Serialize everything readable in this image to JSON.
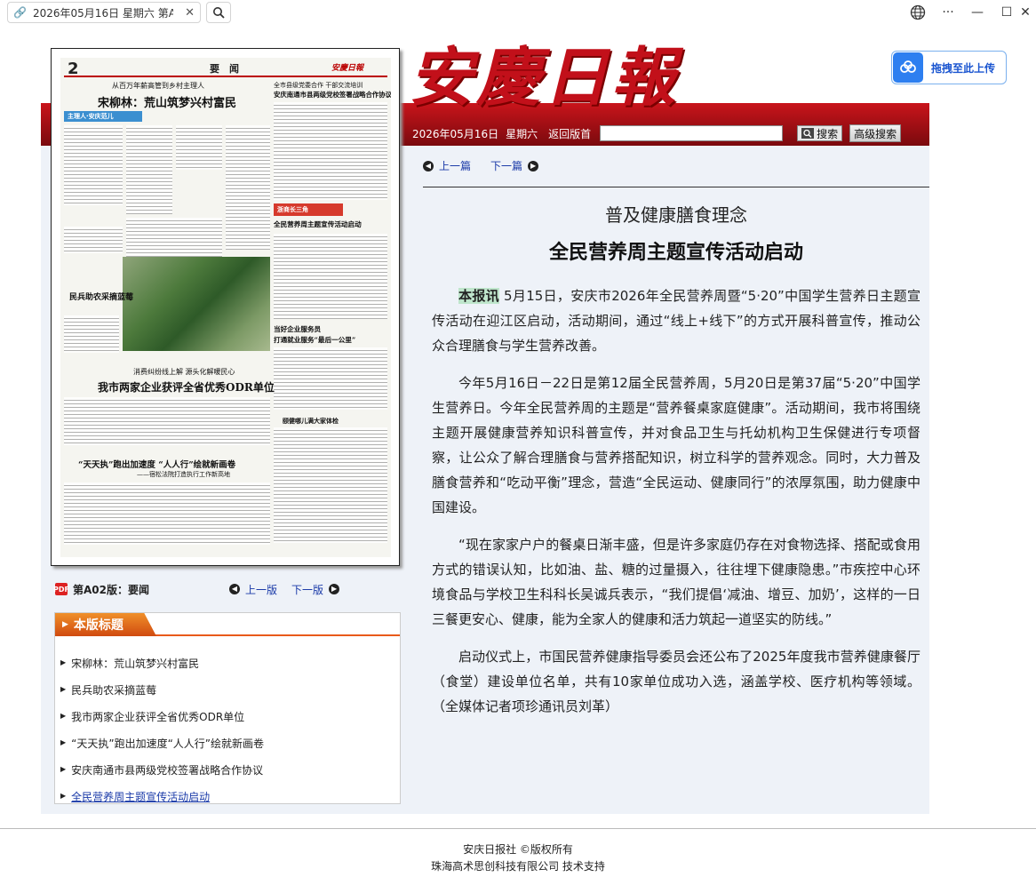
{
  "browser": {
    "tab_title": "2026年05月16日 星期六 第A",
    "tab_close": "✕",
    "search_icon": "magnifier-icon",
    "controls": {
      "globe": "🌐",
      "more": "···",
      "minimize": "—",
      "maximize": "☐",
      "close": "✕"
    }
  },
  "masthead": {
    "logo": "安慶日報",
    "date": "2026年05月16日",
    "weekday": "星期六",
    "back_link": "返回版首",
    "search_placeholder": "",
    "search_label": "搜索",
    "adv_search_label": "高级搜索"
  },
  "upload_widget": {
    "label": "拖拽至此上传"
  },
  "newspaper_thumb": {
    "page_num": "2",
    "section": "要　闻",
    "paper_logo": "安慶日報",
    "head1_kicker": "从百万年薪高管到乡村主理人",
    "head1": "宋柳林：荒山筑梦兴村富民",
    "banner1": "主理人·安庆范儿",
    "head_right_kicker": "全市县级党委合作 干部交流培训",
    "head_right": "安庆南通市县两级党校签署战略合作协议",
    "head2": "民兵助农采摘蓝莓",
    "banner2": "浙商长三角",
    "head3": "全民营养周主题宣传活动启动",
    "head4a": "当好企业服务员",
    "head4b": "打通就业服务“最后一公里”",
    "head5_kicker": "消费纠纷线上解 源头化解暖民心",
    "head5": "我市两家企业获评全省优秀ODR单位",
    "head6": "“天天执”跑出加速度 “人人行”绘就新画卷",
    "head6_sub": "——宿松法院打造执行工作新高地",
    "head7": "颐健哪儿满大家体检"
  },
  "page_nav": {
    "page_label": "第A02版：要闻",
    "prev": "上一版",
    "next": "下一版",
    "pdf_icon": "PDF"
  },
  "headlines": {
    "title": "本版标题",
    "items": [
      {
        "label": "宋柳林：荒山筑梦兴村富民"
      },
      {
        "label": "民兵助农采摘蓝莓"
      },
      {
        "label": "我市两家企业获评全省优秀ODR单位"
      },
      {
        "label": "“天天执”跑出加速度“人人行”绘就新画卷"
      },
      {
        "label": "安庆南通市县两级党校签署战略合作协议"
      },
      {
        "label": "全民营养周主题宣传活动启动"
      }
    ]
  },
  "article": {
    "prev": "上一篇",
    "next": "下一篇",
    "subtitle": "普及健康膳食理念",
    "title": "全民营养周主题宣传活动启动",
    "lead": "本报讯",
    "p1": " 5月15日，安庆市2026年全民营养周暨“5·20”中国学生营养日主题宣传活动在迎江区启动，活动期间，通过“线上+线下”的方式开展科普宣传，推动公众合理膳食与学生营养改善。",
    "p2": "今年5月16日－22日是第12届全民营养周，5月20日是第37届“5·20”中国学生营养日。今年全民营养周的主题是“营养餐桌家庭健康”。活动期间，我市将围绕主题开展健康营养知识科普宣传，并对食品卫生与托幼机构卫生保健进行专项督察，让公众了解合理膳食与营养搭配知识，树立科学的营养观念。同时，大力普及膳食营养和“吃动平衡”理念，营造“全民运动、健康同行”的浓厚氛围，助力健康中国建设。",
    "p3": "“现在家家户户的餐桌日渐丰盛，但是许多家庭仍存在对食物选择、搭配或食用方式的错误认知，比如油、盐、糖的过量摄入，往往埋下健康隐患。”市疾控中心环境食品与学校卫生科科长吴诚兵表示，“我们提倡‘减油、增豆、加奶’，这样的一日三餐更安心、健康，能为全家人的健康和活力筑起一道坚实的防线。”",
    "p4": "启动仪式上，市国民营养健康指导委员会还公布了2025年度我市营养健康餐厅（食堂）建设单位名单，共有10家单位成功入选，涵盖学校、医疗机构等领域。（全媒体记者项珍通讯员刘革）"
  },
  "footer": {
    "line1": "安庆日报社  ©版权所有",
    "line2": "珠海高术思创科技有限公司   技术支持"
  }
}
